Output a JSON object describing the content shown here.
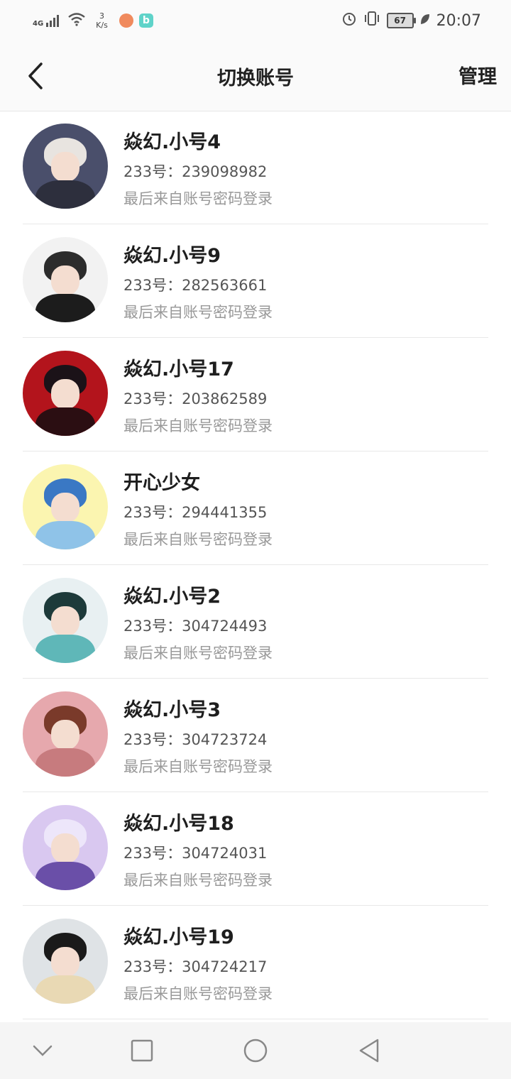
{
  "status_bar": {
    "network_label": "4G",
    "speed_value": "3",
    "speed_unit": "K/s",
    "battery_level": "67",
    "time": "20:07"
  },
  "header": {
    "title": "切换账号",
    "manage_label": "管理"
  },
  "accounts": [
    {
      "name": "焱幻.小号4",
      "id_text": "233号：239098982",
      "login_text": "最后来自账号密码登录",
      "colors": {
        "bg": "#4a4f6b",
        "hair": "#e8e4e0",
        "body": "#2d2f3d"
      }
    },
    {
      "name": "焱幻.小号9",
      "id_text": "233号：282563661",
      "login_text": "最后来自账号密码登录",
      "colors": {
        "bg": "#f2f2f2",
        "hair": "#2c2c2c",
        "body": "#1c1c1c"
      }
    },
    {
      "name": "焱幻.小号17",
      "id_text": "233号：203862589",
      "login_text": "最后来自账号密码登录",
      "colors": {
        "bg": "#b3141c",
        "hair": "#1b1218",
        "body": "#2b0e12"
      }
    },
    {
      "name": "开心少女",
      "id_text": "233号：294441355",
      "login_text": "最后来自账号密码登录",
      "colors": {
        "bg": "#fbf5b0",
        "hair": "#3a78c4",
        "body": "#8fc3e8"
      }
    },
    {
      "name": "焱幻.小号2",
      "id_text": "233号：304724493",
      "login_text": "最后来自账号密码登录",
      "colors": {
        "bg": "#e8f0f2",
        "hair": "#1d3a3a",
        "body": "#5fb7b8"
      }
    },
    {
      "name": "焱幻.小号3",
      "id_text": "233号：304723724",
      "login_text": "最后来自账号密码登录",
      "colors": {
        "bg": "#e6a8ad",
        "hair": "#7a3a2a",
        "body": "#c77b7e"
      }
    },
    {
      "name": "焱幻.小号18",
      "id_text": "233号：304724031",
      "login_text": "最后来自账号密码登录",
      "colors": {
        "bg": "#d9c8f0",
        "hair": "#ede6fa",
        "body": "#6a4fa8"
      }
    },
    {
      "name": "焱幻.小号19",
      "id_text": "233号：304724217",
      "login_text": "最后来自账号密码登录",
      "colors": {
        "bg": "#dfe3e6",
        "hair": "#1a1a1a",
        "body": "#e9d9b4"
      }
    }
  ],
  "icons": {
    "back": "chevron-left-icon",
    "nav": [
      "chevron-down-icon",
      "square-icon",
      "circle-icon",
      "triangle-back-icon"
    ]
  }
}
